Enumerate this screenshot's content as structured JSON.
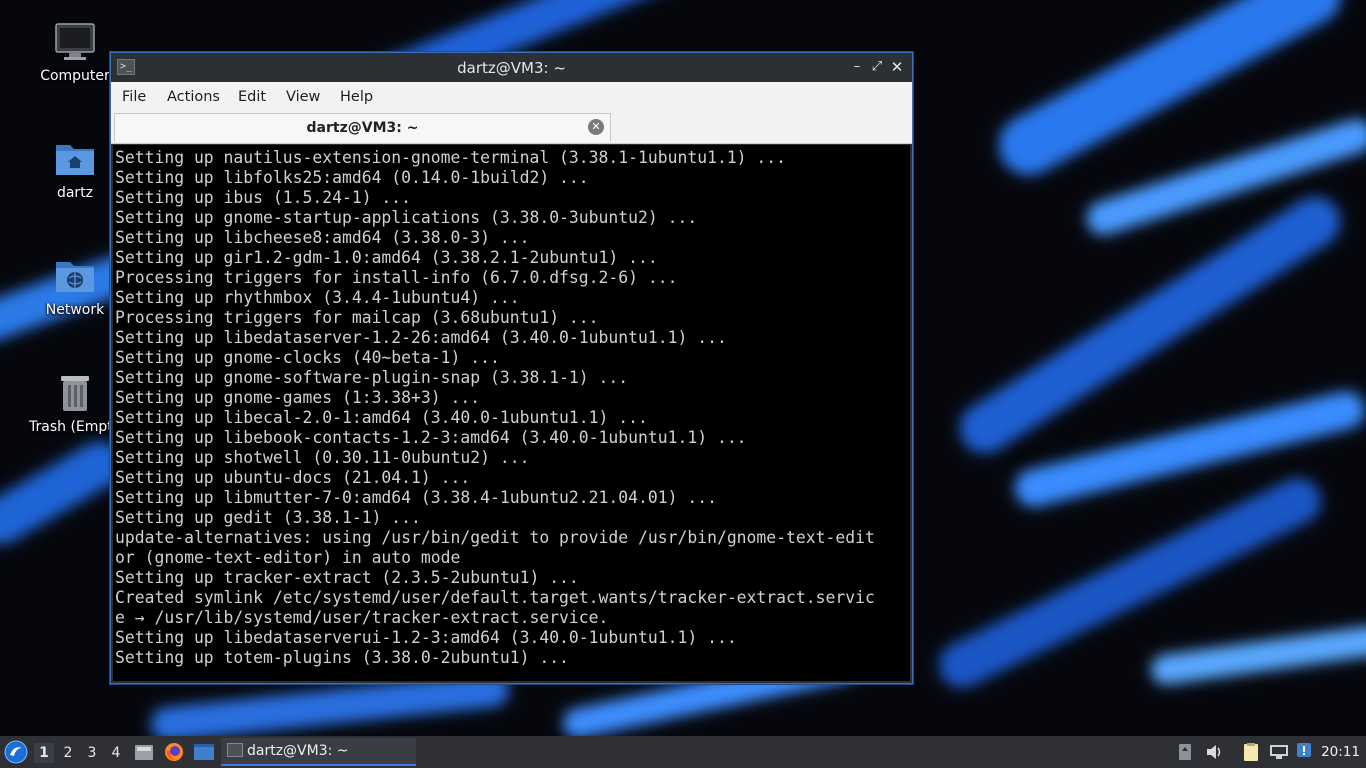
{
  "desktop": {
    "icons": [
      {
        "name": "computer",
        "label": "Computer"
      },
      {
        "name": "home-folder",
        "label": "dartz"
      },
      {
        "name": "network",
        "label": "Network"
      },
      {
        "name": "trash",
        "label": "Trash (Empty)"
      }
    ]
  },
  "window": {
    "title": "dartz@VM3: ~",
    "menu": [
      "File",
      "Actions",
      "Edit",
      "View",
      "Help"
    ],
    "tab": {
      "label": "dartz@VM3: ~"
    },
    "lines": [
      "Setting up nautilus-extension-gnome-terminal (3.38.1-1ubuntu1.1) ...",
      "Setting up libfolks25:amd64 (0.14.0-1build2) ...",
      "Setting up ibus (1.5.24-1) ...",
      "Setting up gnome-startup-applications (3.38.0-3ubuntu2) ...",
      "Setting up libcheese8:amd64 (3.38.0-3) ...",
      "Setting up gir1.2-gdm-1.0:amd64 (3.38.2.1-2ubuntu1) ...",
      "Processing triggers for install-info (6.7.0.dfsg.2-6) ...",
      "Setting up rhythmbox (3.4.4-1ubuntu4) ...",
      "Processing triggers for mailcap (3.68ubuntu1) ...",
      "Setting up libedataserver-1.2-26:amd64 (3.40.0-1ubuntu1.1) ...",
      "Setting up gnome-clocks (40~beta-1) ...",
      "Setting up gnome-software-plugin-snap (3.38.1-1) ...",
      "Setting up gnome-games (1:3.38+3) ...",
      "Setting up libecal-2.0-1:amd64 (3.40.0-1ubuntu1.1) ...",
      "Setting up libebook-contacts-1.2-3:amd64 (3.40.0-1ubuntu1.1) ...",
      "Setting up shotwell (0.30.11-0ubuntu2) ...",
      "Setting up ubuntu-docs (21.04.1) ...",
      "Setting up libmutter-7-0:amd64 (3.38.4-1ubuntu2.21.04.01) ...",
      "Setting up gedit (3.38.1-1) ...",
      "update-alternatives: using /usr/bin/gedit to provide /usr/bin/gnome-text-edit",
      "or (gnome-text-editor) in auto mode",
      "Setting up tracker-extract (2.3.5-2ubuntu1) ...",
      "Created symlink /etc/systemd/user/default.target.wants/tracker-extract.servic",
      "e → /usr/lib/systemd/user/tracker-extract.service.",
      "Setting up libedataserverui-1.2-3:amd64 (3.40.0-1ubuntu1.1) ...",
      "Setting up totem-plugins (3.38.0-2ubuntu1) ..."
    ]
  },
  "taskbar": {
    "workspaces": [
      "1",
      "2",
      "3",
      "4"
    ],
    "active_workspace": "1",
    "task_label": "dartz@VM3: ~",
    "clock": "20:11"
  },
  "colors": {
    "accent": "#3d7be0",
    "terminal_bg": "#000000",
    "terminal_fg": "#d0d0d0"
  }
}
